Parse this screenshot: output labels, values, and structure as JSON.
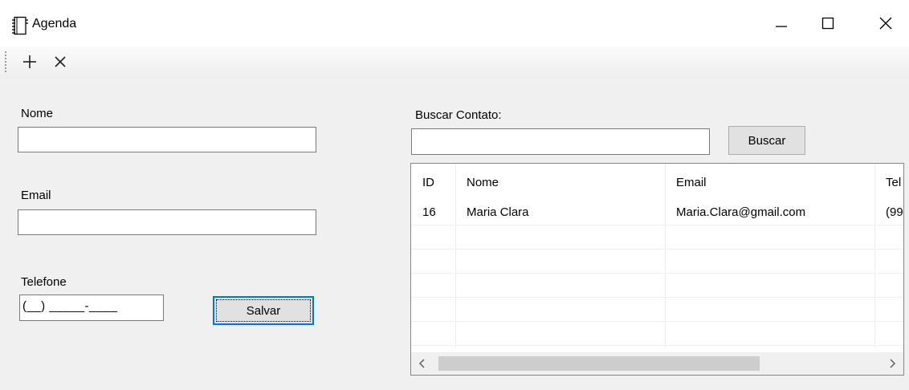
{
  "window": {
    "title": "Agenda",
    "minimize_icon": "minimize-icon",
    "maximize_icon": "maximize-icon",
    "close_icon": "close-icon"
  },
  "toolbar": {
    "add_icon": "plus-icon",
    "remove_icon": "x-icon"
  },
  "form": {
    "nome_label": "Nome",
    "nome_value": "",
    "email_label": "Email",
    "email_value": "",
    "telefone_label": "Telefone",
    "telefone_mask": "(__) _____-____",
    "save_button": "Salvar"
  },
  "search": {
    "label": "Buscar Contato:",
    "value": "",
    "button": "Buscar"
  },
  "grid": {
    "columns": [
      "ID",
      "Nome",
      "Email",
      "Tel"
    ],
    "rows": [
      {
        "id": "16",
        "nome": "Maria Clara",
        "email": "Maria.Clara@gmail.com",
        "tel": "(99"
      }
    ]
  }
}
